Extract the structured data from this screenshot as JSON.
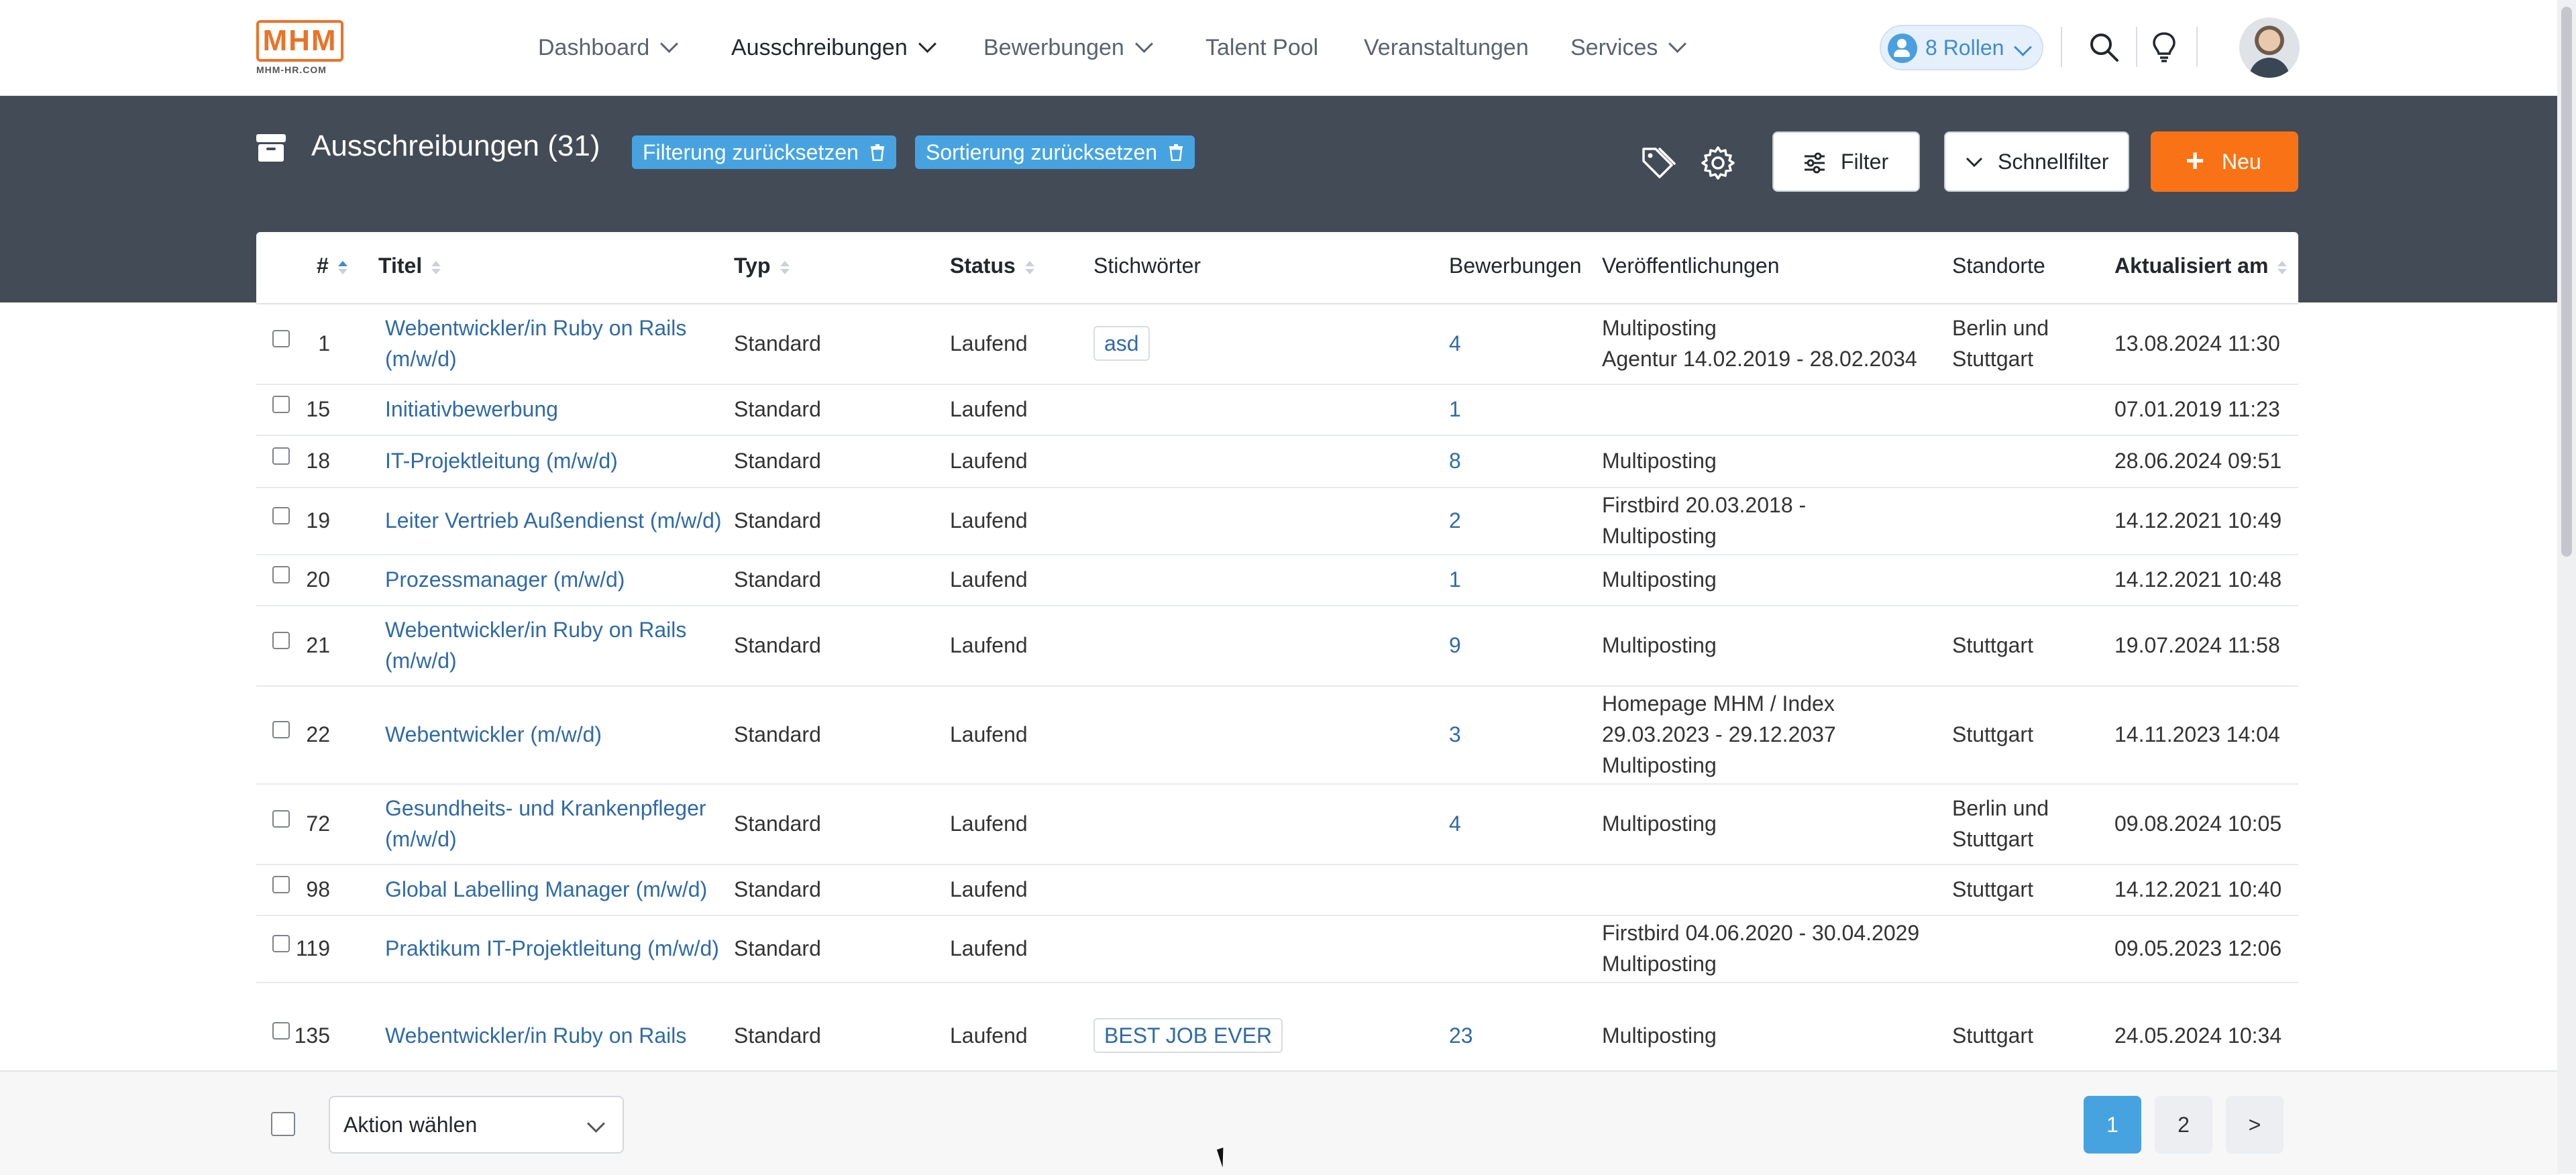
{
  "logo": {
    "mark": "MHM",
    "sub": "MHM-HR.COM"
  },
  "nav": {
    "items": [
      {
        "label": "Dashboard"
      },
      {
        "label": "Ausschreibungen"
      },
      {
        "label": "Bewerbungen"
      },
      {
        "label": "Talent Pool"
      },
      {
        "label": "Veranstaltungen"
      },
      {
        "label": "Services"
      }
    ],
    "active": "Ausschreibungen",
    "roles_label": "8 Rollen"
  },
  "page": {
    "title": "Ausschreibungen (31)",
    "reset_filter": "Filterung zurücksetzen",
    "reset_sort": "Sortierung zurücksetzen",
    "filter_label": "Filter",
    "quickfilter_label": "Schnellfilter",
    "new_label": "Neu"
  },
  "table": {
    "columns": [
      "#",
      "Titel",
      "Typ",
      "Status",
      "Stichwörter",
      "Bewerbungen",
      "Veröffentlichungen",
      "Standorte",
      "Aktualisiert am"
    ],
    "rows": [
      {
        "id": "1",
        "title1": "Webentwickler/in Ruby on Rails",
        "title2": "(m/w/d)",
        "typ": "Standard",
        "status": "Laufend",
        "tag": "asd",
        "bew": "4",
        "pub1": "Multiposting",
        "pub2": "Agentur 14.02.2019 - 28.02.2034",
        "pub3": "",
        "ort1": "Berlin und",
        "ort2": "Stuttgart",
        "upd": "13.08.2024 11:30"
      },
      {
        "id": "15",
        "title1": "Initiativbewerbung",
        "title2": "",
        "typ": "Standard",
        "status": "Laufend",
        "tag": "",
        "bew": "1",
        "pub1": "",
        "pub2": "",
        "pub3": "",
        "ort1": "",
        "ort2": "",
        "upd": "07.01.2019 11:23"
      },
      {
        "id": "18",
        "title1": "IT-Projektleitung (m/w/d)",
        "title2": "",
        "typ": "Standard",
        "status": "Laufend",
        "tag": "",
        "bew": "8",
        "pub1": "Multiposting",
        "pub2": "",
        "pub3": "",
        "ort1": "",
        "ort2": "",
        "upd": "28.06.2024 09:51"
      },
      {
        "id": "19",
        "title1": "Leiter Vertrieb Außendienst (m/w/d)",
        "title2": "",
        "typ": "Standard",
        "status": "Laufend",
        "tag": "",
        "bew": "2",
        "pub1": "Firstbird 20.03.2018 -",
        "pub2": "Multiposting",
        "pub3": "",
        "ort1": "",
        "ort2": "",
        "upd": "14.12.2021 10:49"
      },
      {
        "id": "20",
        "title1": "Prozessmanager (m/w/d)",
        "title2": "",
        "typ": "Standard",
        "status": "Laufend",
        "tag": "",
        "bew": "1",
        "pub1": "Multiposting",
        "pub2": "",
        "pub3": "",
        "ort1": "",
        "ort2": "",
        "upd": "14.12.2021 10:48"
      },
      {
        "id": "21",
        "title1": "Webentwickler/in Ruby on Rails",
        "title2": "(m/w/d)",
        "typ": "Standard",
        "status": "Laufend",
        "tag": "",
        "bew": "9",
        "pub1": "Multiposting",
        "pub2": "",
        "pub3": "",
        "ort1": "Stuttgart",
        "ort2": "",
        "upd": "19.07.2024 11:58"
      },
      {
        "id": "22",
        "title1": "Webentwickler (m/w/d)",
        "title2": "",
        "typ": "Standard",
        "status": "Laufend",
        "tag": "",
        "bew": "3",
        "pub1": "Homepage MHM / Index",
        "pub2": "29.03.2023 - 29.12.2037",
        "pub3": "Multiposting",
        "ort1": "Stuttgart",
        "ort2": "",
        "upd": "14.11.2023 14:04"
      },
      {
        "id": "72",
        "title1": "Gesundheits- und Krankenpfleger",
        "title2": "(m/w/d)",
        "typ": "Standard",
        "status": "Laufend",
        "tag": "",
        "bew": "4",
        "pub1": "Multiposting",
        "pub2": "",
        "pub3": "",
        "ort1": "Berlin und",
        "ort2": "Stuttgart",
        "upd": "09.08.2024 10:05"
      },
      {
        "id": "98",
        "title1": "Global Labelling Manager (m/w/d)",
        "title2": "",
        "typ": "Standard",
        "status": "Laufend",
        "tag": "",
        "bew": "",
        "pub1": "",
        "pub2": "",
        "pub3": "",
        "ort1": "Stuttgart",
        "ort2": "",
        "upd": "14.12.2021 10:40"
      },
      {
        "id": "119",
        "title1": "Praktikum IT-Projektleitung (m/w/d)",
        "title2": "",
        "typ": "Standard",
        "status": "Laufend",
        "tag": "",
        "bew": "",
        "pub1": "Firstbird 04.06.2020 - 30.04.2029",
        "pub2": "Multiposting",
        "pub3": "",
        "ort1": "",
        "ort2": "",
        "upd": "09.05.2023 12:06"
      },
      {
        "id": "135",
        "title1": "Webentwickler/in Ruby on Rails",
        "title2": "",
        "typ": "Standard",
        "status": "Laufend",
        "tag": "BEST JOB EVER",
        "bew": "23",
        "pub1": "Multiposting",
        "pub2": "",
        "pub3": "",
        "ort1": "Stuttgart",
        "ort2": "",
        "upd": "24.05.2024 10:34"
      }
    ]
  },
  "footer": {
    "action_placeholder": "Aktion wählen",
    "pages": [
      "1",
      "2",
      ">"
    ],
    "current_page": "1"
  },
  "colors": {
    "accent": "#f97316",
    "primary": "#47a3e0",
    "link": "#2f6aa8",
    "band": "#434b57"
  }
}
